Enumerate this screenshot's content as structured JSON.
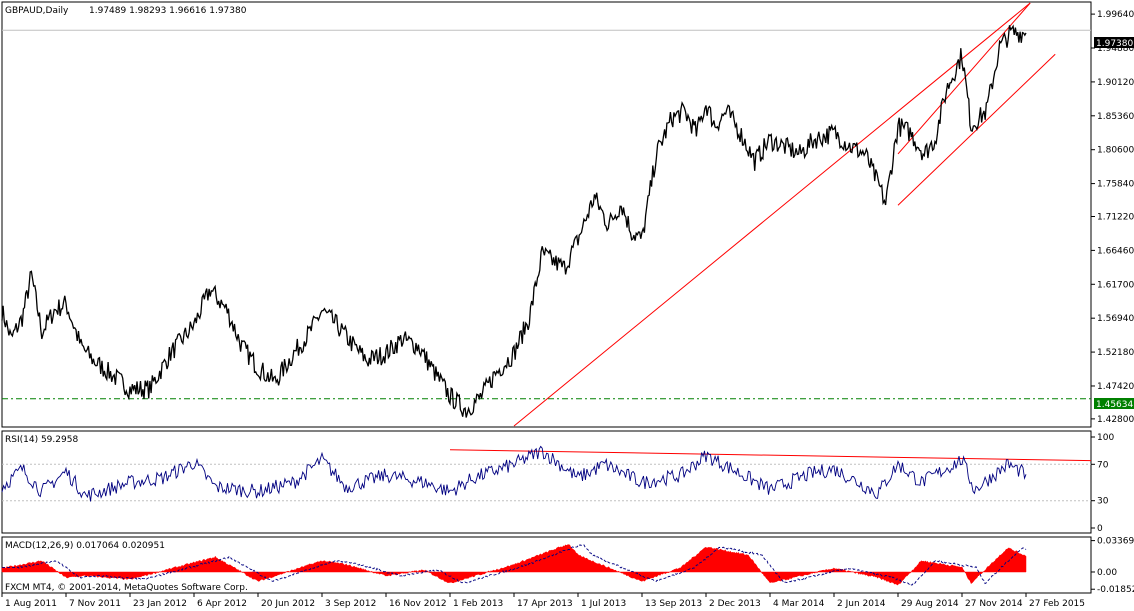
{
  "header": {
    "symbol": "GBPAUD,Daily",
    "ohlc": "1.97489 1.98293 1.96616 1.97380"
  },
  "watermark": "FXCM MT4, © 2001-2014, MetaQuotes Software Corp.",
  "colors": {
    "price_line": "#000000",
    "trend_lines": "#ff0000",
    "support_line": "#008000",
    "rsi_line": "#000080",
    "macd_hist": "#ff0000",
    "macd_signal": "#000080",
    "current_price_tag": "#000000",
    "support_tag": "#008000"
  },
  "chart_data": [
    {
      "type": "line",
      "title": "GBPAUD,Daily",
      "price_axis": {
        "ticks": [
          "1.99640",
          "1.94880",
          "1.90120",
          "1.85360",
          "1.80600",
          "1.75840",
          "1.71220",
          "1.66460",
          "1.61700",
          "1.56940",
          "1.52180",
          "1.47420",
          "1.42800"
        ],
        "ylim": [
          1.418,
          2.012
        ]
      },
      "x_ticks": [
        "1 Aug 2011",
        "7 Nov 2011",
        "23 Jan 2012",
        "6 Apr 2012",
        "20 Jun 2012",
        "3 Sep 2012",
        "16 Nov 2012",
        "1 Feb 2013",
        "17 Apr 2013",
        "1 Jul 2013",
        "13 Sep 2013",
        "2 Dec 2013",
        "4 Mar 2014",
        "2 Jun 2014",
        "29 Aug 2014",
        "27 Nov 2014",
        "27 Feb 2015"
      ],
      "series": [
        {
          "x": [
            "1 Aug 2011",
            "15 Aug 2011",
            "1 Sep 2011",
            "15 Sep 2011",
            "1 Oct 2011",
            "20 Oct 2011",
            "7 Nov 2011",
            "25 Nov 2011",
            "10 Dec 2011",
            "1 Jan 2012",
            "23 Jan 2012",
            "15 Feb 2012",
            "10 Mar 2012",
            "6 Apr 2012",
            "25 Apr 2012",
            "15 May 2012",
            "1 Jun 2012",
            "20 Jun 2012",
            "10 Jul 2012",
            "1 Aug 2012",
            "20 Aug 2012",
            "3 Sep 2012",
            "20 Sep 2012",
            "10 Oct 2012",
            "25 Oct 2012",
            "16 Nov 2012",
            "5 Dec 2012",
            "25 Dec 2012",
            "15 Jan 2013",
            "1 Feb 2013",
            "20 Feb 2013",
            "10 Mar 2013",
            "25 Mar 2013",
            "17 Apr 2013",
            "5 May 2013",
            "20 May 2013",
            "1 Jun 2013",
            "15 Jun 2013",
            "1 Jul 2013",
            "20 Jul 2013",
            "5 Aug 2013",
            "20 Aug 2013",
            "1 Sep 2013",
            "13 Sep 2013",
            "1 Oct 2013",
            "20 Oct 2013",
            "5 Nov 2013",
            "20 Nov 2013",
            "2 Dec 2013",
            "15 Dec 2013",
            "1 Jan 2014",
            "20 Jan 2014",
            "10 Feb 2014",
            "4 Mar 2014",
            "25 Mar 2014",
            "15 Apr 2014",
            "5 May 2014",
            "2 Jun 2014",
            "25 Jun 2014",
            "15 Jul 2014",
            "5 Aug 2014",
            "12 Aug 2014",
            "29 Aug 2014",
            "15 Sep 2014",
            "5 Oct 2014",
            "20 Oct 2014",
            "5 Nov 2014",
            "27 Nov 2014",
            "10 Dec 2014",
            "1 Jan 2015",
            "20 Jan 2015",
            "5 Feb 2015",
            "27 Feb 2015"
          ],
          "values": [
            1.58,
            1.54,
            1.57,
            1.63,
            1.55,
            1.58,
            1.59,
            1.53,
            1.51,
            1.49,
            1.47,
            1.47,
            1.52,
            1.56,
            1.61,
            1.58,
            1.53,
            1.5,
            1.48,
            1.52,
            1.55,
            1.58,
            1.56,
            1.53,
            1.51,
            1.52,
            1.54,
            1.53,
            1.49,
            1.46,
            1.44,
            1.46,
            1.49,
            1.52,
            1.57,
            1.66,
            1.65,
            1.64,
            1.68,
            1.74,
            1.7,
            1.73,
            1.69,
            1.68,
            1.8,
            1.85,
            1.86,
            1.83,
            1.87,
            1.84,
            1.86,
            1.83,
            1.79,
            1.82,
            1.81,
            1.8,
            1.82,
            1.83,
            1.81,
            1.8,
            1.75,
            1.73,
            1.84,
            1.83,
            1.8,
            1.82,
            1.89,
            1.94,
            1.84,
            1.86,
            1.95,
            1.97,
            1.97
          ]
        }
      ],
      "annotations": {
        "current_price": "1.97380",
        "support_level": "1.45634",
        "trend_channel": "rising"
      }
    },
    {
      "type": "line",
      "title": "RSI(14) 59.2958",
      "ylim": [
        0,
        100
      ],
      "y_ticks": [
        "100",
        "70",
        "30",
        "0"
      ],
      "series": [
        {
          "x": [
            "1 Aug 2011",
            "1 Sep 2011",
            "1 Oct 2011",
            "7 Nov 2011",
            "1 Dec 2011",
            "23 Jan 2012",
            "1 Mar 2012",
            "6 Apr 2012",
            "1 May 2012",
            "20 Jun 2012",
            "1 Aug 2012",
            "3 Sep 2012",
            "1 Oct 2012",
            "16 Nov 2012",
            "1 Jan 2013",
            "1 Feb 2013",
            "1 Mar 2013",
            "17 Apr 2013",
            "20 May 2013",
            "1 Jul 2013",
            "1 Aug 2013",
            "13 Sep 2013",
            "1 Nov 2013",
            "2 Dec 2013",
            "1 Feb 2014",
            "4 Mar 2014",
            "1 May 2014",
            "2 Jun 2014",
            "1 Aug 2014",
            "29 Aug 2014",
            "1 Oct 2014",
            "27 Nov 2014",
            "15 Dec 2014",
            "1 Feb 2015",
            "27 Feb 2015"
          ],
          "values": [
            45,
            65,
            40,
            62,
            35,
            50,
            55,
            72,
            45,
            40,
            50,
            75,
            45,
            58,
            50,
            40,
            55,
            70,
            85,
            55,
            70,
            50,
            58,
            80,
            55,
            42,
            60,
            65,
            38,
            70,
            50,
            75,
            42,
            70,
            59
          ]
        }
      ]
    },
    {
      "type": "area",
      "title": "MACD(12,26,9) 0.017064 0.020951",
      "y_ticks": [
        "0.033696",
        "0.00",
        "-0.01852"
      ],
      "ylim": [
        -0.0215,
        0.0365
      ],
      "series": [
        {
          "x": [
            "1 Aug 2011",
            "1 Oct 2011",
            "7 Nov 2011",
            "1 Dec 2011",
            "23 Jan 2012",
            "6 Apr 2012",
            "1 May 2012",
            "20 Jun 2012",
            "3 Sep 2012",
            "1 Oct 2012",
            "16 Nov 2012",
            "1 Jan 2013",
            "1 Feb 2013",
            "17 Apr 2013",
            "20 Jun 2013",
            "1 Jul 2013",
            "13 Sep 2013",
            "1 Nov 2013",
            "2 Dec 2013",
            "1 Feb 2014",
            "4 Mar 2014",
            "2 Jun 2014",
            "1 Aug 2014",
            "29 Aug 2014",
            "1 Oct 2014",
            "27 Nov 2014",
            "10 Dec 2014",
            "1 Feb 2015",
            "27 Feb 2015"
          ],
          "values": [
            0.004,
            0.012,
            -0.006,
            -0.004,
            -0.008,
            0.01,
            0.016,
            -0.01,
            0.012,
            0.008,
            -0.004,
            0.002,
            -0.012,
            0.008,
            0.03,
            0.018,
            -0.01,
            0.005,
            0.027,
            0.018,
            -0.012,
            0.004,
            -0.006,
            -0.014,
            0.012,
            0.005,
            -0.012,
            0.026,
            0.017
          ]
        }
      ]
    }
  ]
}
